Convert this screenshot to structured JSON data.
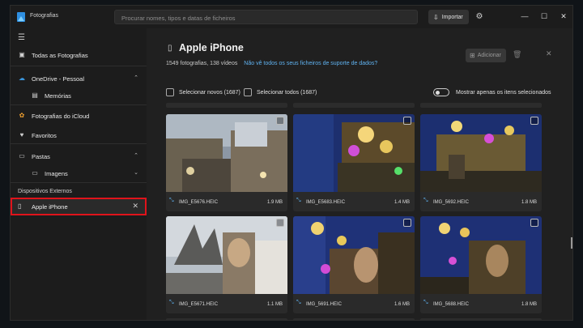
{
  "titlebar": {
    "app_name": "Fotografias",
    "search_placeholder": "Procurar nomes, tipos e datas de ficheiros",
    "import_label": "Importar",
    "minimize": "—",
    "maximize": "☐",
    "close": "✕"
  },
  "sidebar": {
    "items": [
      {
        "label": "Todas as Fotografias",
        "icon": "photos-icon"
      },
      {
        "label": "OneDrive - Pessoal",
        "icon": "cloud-icon"
      },
      {
        "label": "Memórias",
        "icon": "memories-icon"
      },
      {
        "label": "Fotografias do iCloud",
        "icon": "icloud-icon"
      },
      {
        "label": "Favoritos",
        "icon": "heart-icon"
      },
      {
        "label": "Pastas",
        "icon": "folder-icon"
      },
      {
        "label": "Imagens",
        "icon": "folder-icon"
      }
    ],
    "section_label": "Dispositivos Externos",
    "device": {
      "label": "Apple iPhone",
      "icon": "phone-icon",
      "close": "✕"
    }
  },
  "main": {
    "title": "Apple iPhone",
    "summary": "1549 fotografias, 138 vídeos",
    "link": "Não vê todos os seus ficheiros de suporte de dados?",
    "add_label": "Adicionar",
    "select_new": "Selecionar novos (1687)",
    "select_all": "Selecionar todos (1687)",
    "show_selected": "Mostrar apenas os itens selecionados",
    "photos": [
      {
        "name": "IMG_E5676.HEIC",
        "size": "1.9 MB"
      },
      {
        "name": "IMG_E5683.HEIC",
        "size": "1.4 MB"
      },
      {
        "name": "IMG_5692.HEIC",
        "size": "1.8 MB"
      },
      {
        "name": "IMG_E5671.HEIC",
        "size": "1.1 MB"
      },
      {
        "name": "IMG_5691.HEIC",
        "size": "1.6 MB"
      },
      {
        "name": "IMG_5688.HEIC",
        "size": "1.8 MB"
      }
    ]
  },
  "colors": {
    "accent": "#5fb2f0",
    "highlight_border": "#e0131b"
  }
}
